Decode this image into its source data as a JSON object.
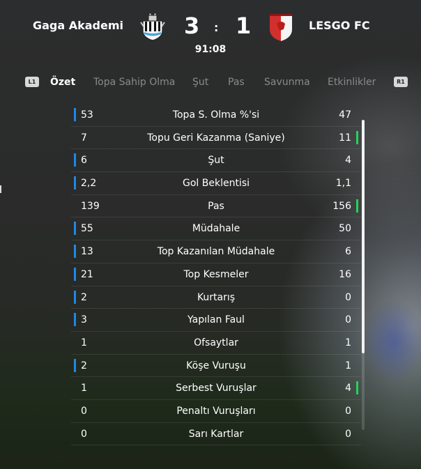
{
  "match": {
    "home": {
      "name": "Gaga Akademi",
      "score": "3"
    },
    "away": {
      "name": "LESGO FC",
      "score": "1"
    },
    "separator": ":",
    "clock": "91:08"
  },
  "tabs": {
    "left_hint": "L1",
    "right_hint": "R1",
    "items": [
      "Özet",
      "Topa Sahip Olma",
      "Şut",
      "Pas",
      "Savunma",
      "Etkinlikler"
    ]
  },
  "stats": [
    {
      "label": "Topa S. Olma %'si",
      "home": "53",
      "away": "47",
      "lead": "home"
    },
    {
      "label": "Topu Geri Kazanma (Saniye)",
      "home": "7",
      "away": "11",
      "lead": "away"
    },
    {
      "label": "Şut",
      "home": "6",
      "away": "4",
      "lead": "home"
    },
    {
      "label": "Gol Beklentisi",
      "home": "2,2",
      "away": "1,1",
      "lead": "home"
    },
    {
      "label": "Pas",
      "home": "139",
      "away": "156",
      "lead": "away"
    },
    {
      "label": "Müdahale",
      "home": "55",
      "away": "50",
      "lead": "home"
    },
    {
      "label": "Top Kazanılan Müdahale",
      "home": "13",
      "away": "6",
      "lead": "home"
    },
    {
      "label": "Top Kesmeler",
      "home": "21",
      "away": "16",
      "lead": "home"
    },
    {
      "label": "Kurtarış",
      "home": "2",
      "away": "0",
      "lead": "home"
    },
    {
      "label": "Yapılan Faul",
      "home": "3",
      "away": "0",
      "lead": "home"
    },
    {
      "label": "Ofsaytlar",
      "home": "1",
      "away": "1",
      "lead": "none"
    },
    {
      "label": "Köşe Vuruşu",
      "home": "2",
      "away": "1",
      "lead": "home"
    },
    {
      "label": "Serbest Vuruşlar",
      "home": "1",
      "away": "4",
      "lead": "away"
    },
    {
      "label": "Penaltı Vuruşları",
      "home": "0",
      "away": "0",
      "lead": "none"
    },
    {
      "label": "Sarı Kartlar",
      "home": "0",
      "away": "0",
      "lead": "none"
    }
  ],
  "colors": {
    "home_lead": "#1e88e5",
    "away_lead": "#22d35a",
    "away_crest": "#d32f2f"
  },
  "icons": {
    "home_crest": "newcastle-crest-icon",
    "away_crest": "lesgo-crest-icon"
  }
}
